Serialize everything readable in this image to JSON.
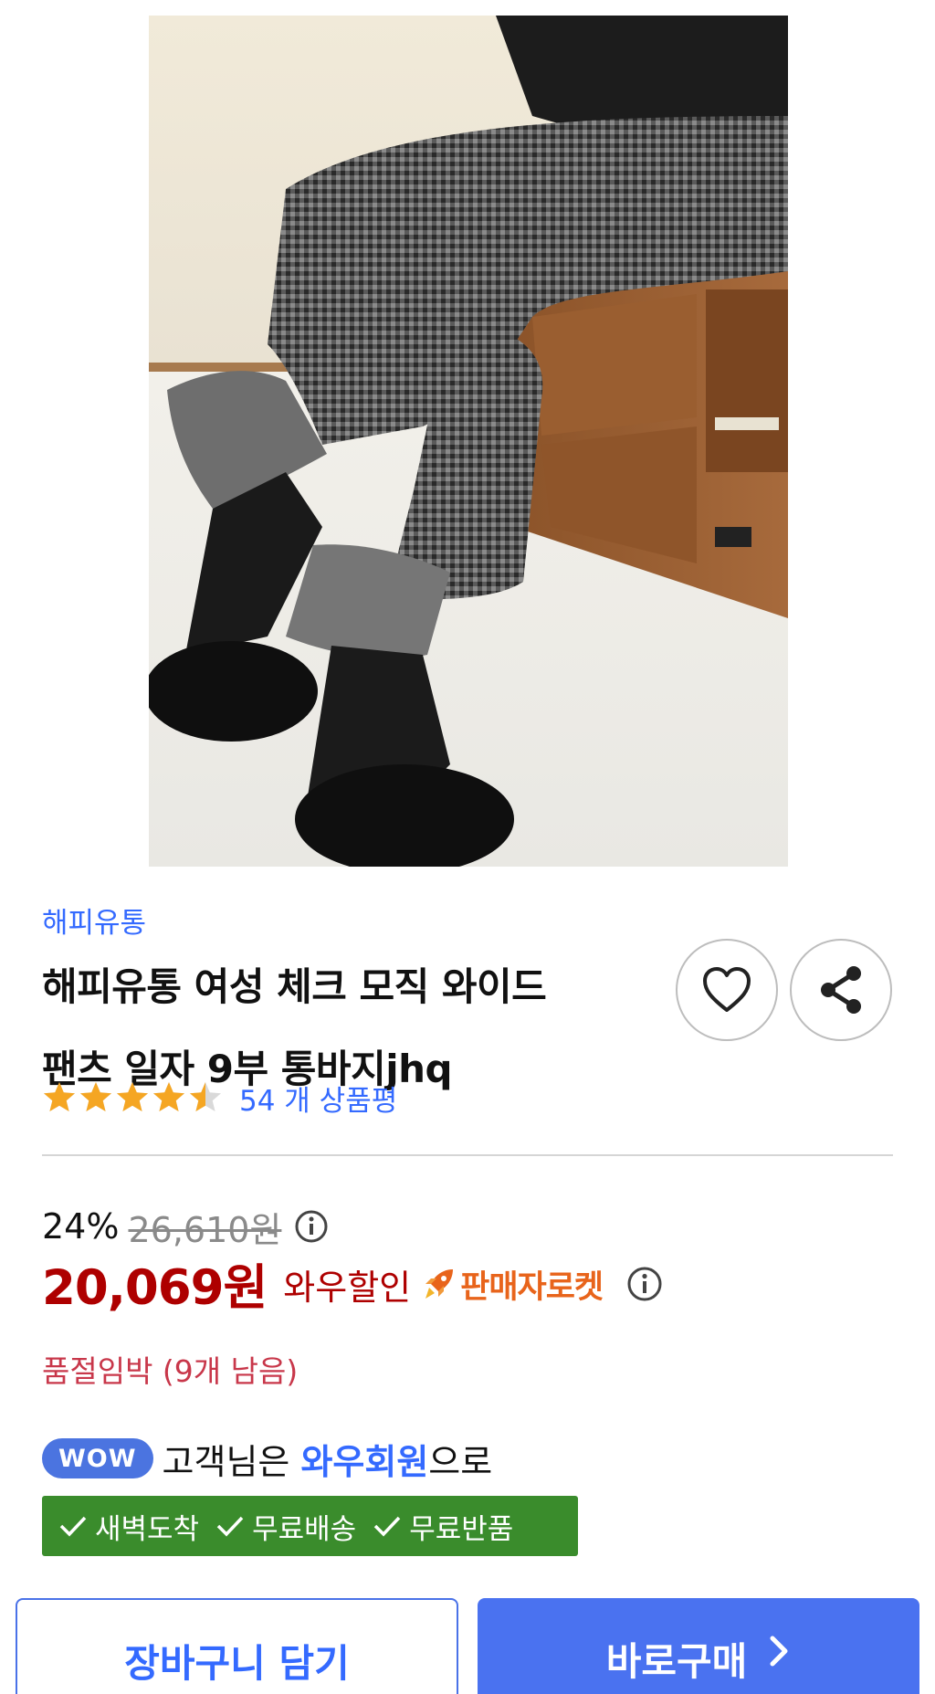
{
  "product": {
    "brand": "해피유통",
    "title_line1": "해피유통 여성 체크 모직 와이드",
    "title_line2": "팬츠 일자 9부 통바지jhq",
    "rating": 4.5,
    "review_count": "54 개 상품평"
  },
  "price": {
    "discount_rate": "24%",
    "original_price": "26,610원",
    "sale_price": "20,069원",
    "wow_label": "와우할인",
    "rocket_label": "판매자로켓"
  },
  "stock": {
    "text": "품절임박 (9개 남음)"
  },
  "wow": {
    "badge": "WOW",
    "text_before": "고객님은 ",
    "member": "와우회원",
    "text_after": "으로"
  },
  "benefits": [
    "새벽도착",
    "무료배송",
    "무료반품"
  ],
  "actions": {
    "cart_label": "장바구니 담기",
    "buy_label": "바로구매"
  },
  "icons": {
    "wish": "heart-icon",
    "share": "share-icon",
    "info": "info-icon",
    "rocket": "rocket-icon",
    "check": "check-icon",
    "chevron": "chevron-right-icon",
    "star": "star-icon"
  },
  "colors": {
    "brand_link": "#346aff",
    "sale_price": "#ae0000",
    "stock": "#c8374a",
    "benefit_bg": "#3a8c2c",
    "buy_bg": "#4a72f0",
    "star": "#f5a623"
  }
}
